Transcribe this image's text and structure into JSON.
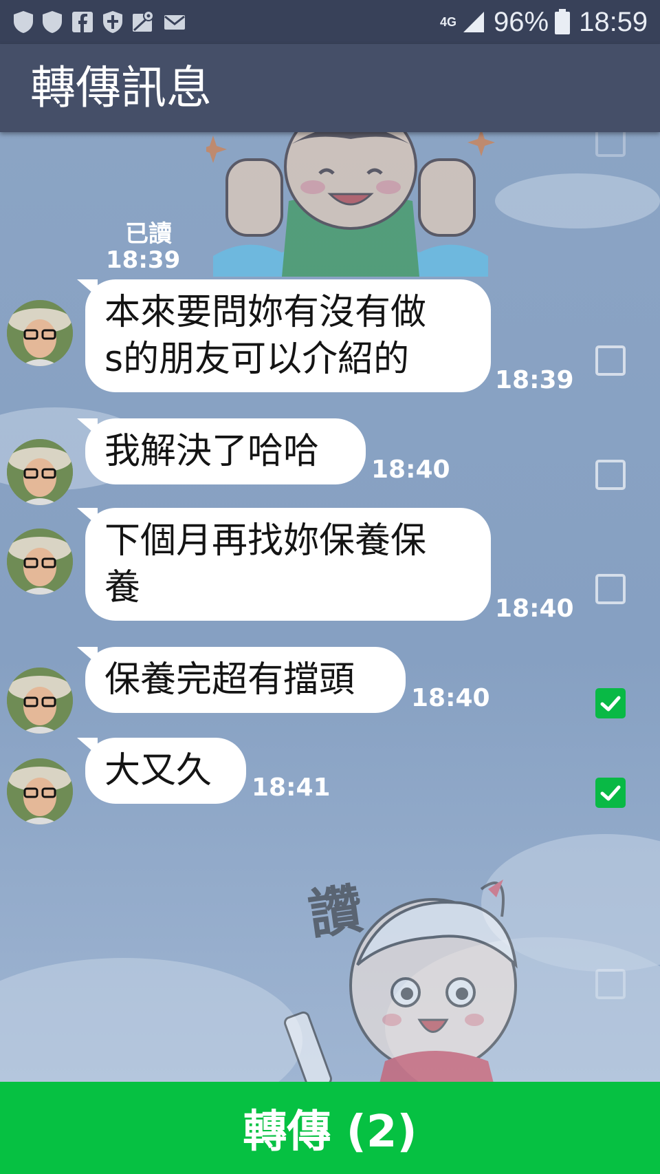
{
  "status_bar": {
    "network": "4G",
    "battery": "96%",
    "time": "18:59",
    "left_icons": [
      "shield-icon",
      "shield-icon",
      "facebook-icon",
      "security-shield-icon",
      "maps-icon",
      "mail-icon"
    ]
  },
  "header": {
    "title": "轉傳訊息"
  },
  "read_receipt": {
    "label": "已讀",
    "time": "18:39"
  },
  "messages": [
    {
      "lines": [
        "本來要問妳有沒有做",
        "s的朋友可以介紹的"
      ],
      "time": "18:39",
      "checked": false
    },
    {
      "lines": [
        "我解決了哈哈"
      ],
      "time": "18:40",
      "checked": false
    },
    {
      "lines": [
        "下個月再找妳保養保",
        "養"
      ],
      "time": "18:40",
      "checked": false
    },
    {
      "lines": [
        "保養完超有擋頭"
      ],
      "time": "18:40",
      "checked": true
    },
    {
      "lines": [
        "大又久"
      ],
      "time": "18:41",
      "checked": true
    }
  ],
  "sticker_bottom": {
    "text": "讚"
  },
  "forward_button": {
    "label": "轉傳 (2)"
  },
  "colors": {
    "status_bar": "#384159",
    "header": "#454f68",
    "chat_background": "#8aa3c3",
    "accent_green": "#06c142"
  }
}
